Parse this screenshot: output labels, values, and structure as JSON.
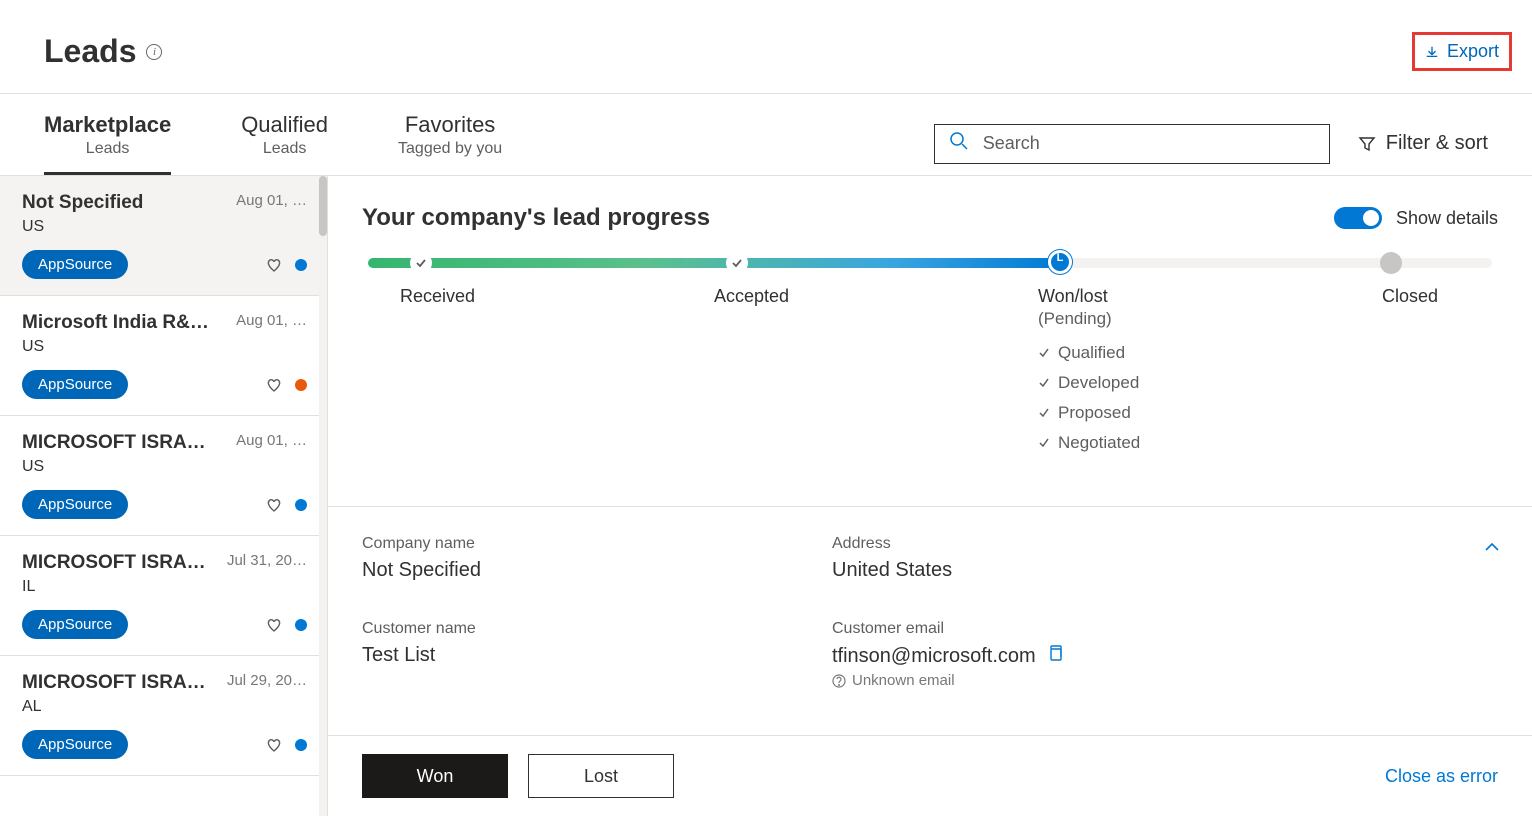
{
  "header": {
    "title": "Leads",
    "export_label": "Export"
  },
  "tabs": [
    {
      "main": "Marketplace",
      "sub": "Leads",
      "active": true
    },
    {
      "main": "Qualified",
      "sub": "Leads",
      "active": false
    },
    {
      "main": "Favorites",
      "sub": "Tagged by you",
      "active": false
    }
  ],
  "search": {
    "placeholder": "Search"
  },
  "filter_label": "Filter & sort",
  "leads": [
    {
      "name": "Not Specified",
      "loc": "US",
      "date": "Aug 01, …",
      "source": "AppSource",
      "dot": "blue",
      "selected": true
    },
    {
      "name": "Microsoft India R&…",
      "loc": "US",
      "date": "Aug 01, …",
      "source": "AppSource",
      "dot": "orange",
      "selected": false
    },
    {
      "name": "MICROSOFT ISRAE…",
      "loc": "US",
      "date": "Aug 01, …",
      "source": "AppSource",
      "dot": "blue",
      "selected": false
    },
    {
      "name": "MICROSOFT ISRAE…",
      "loc": "IL",
      "date": "Jul 31, 20…",
      "source": "AppSource",
      "dot": "blue",
      "selected": false
    },
    {
      "name": "MICROSOFT ISRAE…",
      "loc": "AL",
      "date": "Jul 29, 20…",
      "source": "AppSource",
      "dot": "blue",
      "selected": false
    }
  ],
  "progress": {
    "title": "Your company's lead progress",
    "show_details_label": "Show details",
    "stages": {
      "received": "Received",
      "accepted": "Accepted",
      "wonlost": "Won/lost",
      "wonlost_sub": "(Pending)",
      "closed": "Closed"
    },
    "checklist": [
      "Qualified",
      "Developed",
      "Proposed",
      "Negotiated"
    ]
  },
  "details": {
    "company_label": "Company name",
    "company_val": "Not Specified",
    "address_label": "Address",
    "address_val": "United States",
    "customer_label": "Customer name",
    "customer_val": "Test List",
    "email_label": "Customer email",
    "email_val": "tfinson@microsoft.com",
    "unknown_email": "Unknown email"
  },
  "actions": {
    "won": "Won",
    "lost": "Lost",
    "close_error": "Close as error"
  }
}
